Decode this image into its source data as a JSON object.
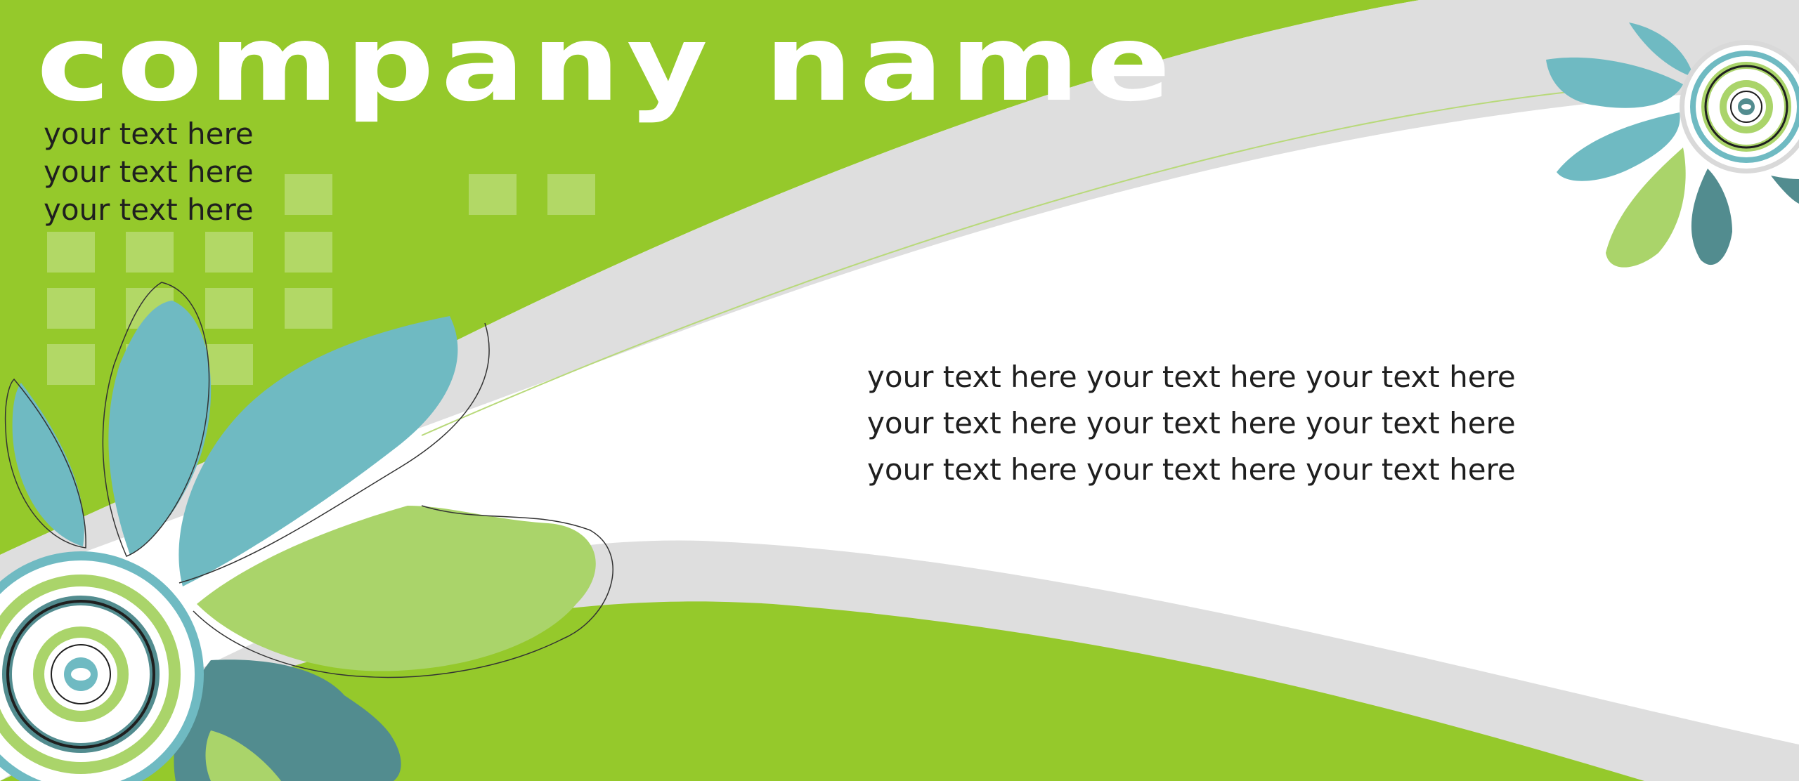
{
  "banner": {
    "company_name": "company name",
    "tagline_lines": [
      "your text here",
      "your text here",
      "your text here"
    ],
    "body_lines": [
      "your text here your text here your text here",
      "your text here your text here your text here",
      "your text here your text here your text here"
    ]
  },
  "colors": {
    "green": "#95c92b",
    "light_green": "#aad46a",
    "teal": "#6fbac2",
    "dark_teal": "#528c8f",
    "gray": "#dedede",
    "white": "#ffffff",
    "text": "#1f1f1f"
  }
}
